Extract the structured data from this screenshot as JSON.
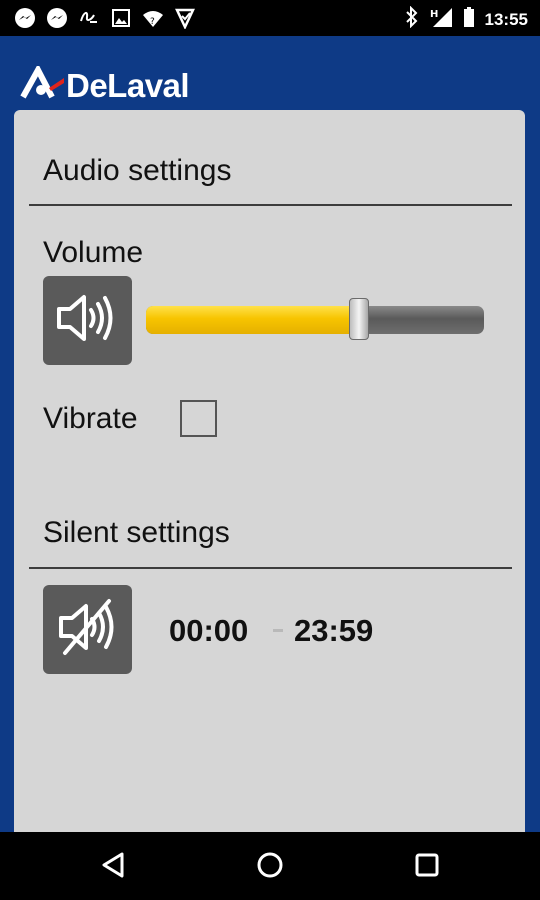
{
  "status_bar": {
    "time": "13:55",
    "network_label": "H",
    "left_icons": [
      "messenger-icon",
      "messenger-icon",
      "gesture-icon",
      "image-icon",
      "wifi-question-icon",
      "download-check-icon"
    ],
    "right_icons": [
      "bluetooth-icon",
      "signal-icon",
      "battery-icon"
    ]
  },
  "header": {
    "brand": "DeLaval",
    "logo_icon": "delaval-logo-icon"
  },
  "colors": {
    "background": "#0e3a86",
    "panel": "#d6d6d6",
    "slider_fill": "#f7c400",
    "icon_button": "#5a5a5a"
  },
  "audio": {
    "title": "Audio settings",
    "volume_label": "Volume",
    "volume_level": 0.63,
    "volume_icon": "speaker-icon",
    "vibrate_label": "Vibrate",
    "vibrate_checked": false
  },
  "silent": {
    "title": "Silent settings",
    "mute_icon": "speaker-muted-icon",
    "start_time": "00:00",
    "end_time": "23:59"
  },
  "nav": {
    "icons": [
      "back-icon",
      "home-icon",
      "recents-icon"
    ]
  }
}
